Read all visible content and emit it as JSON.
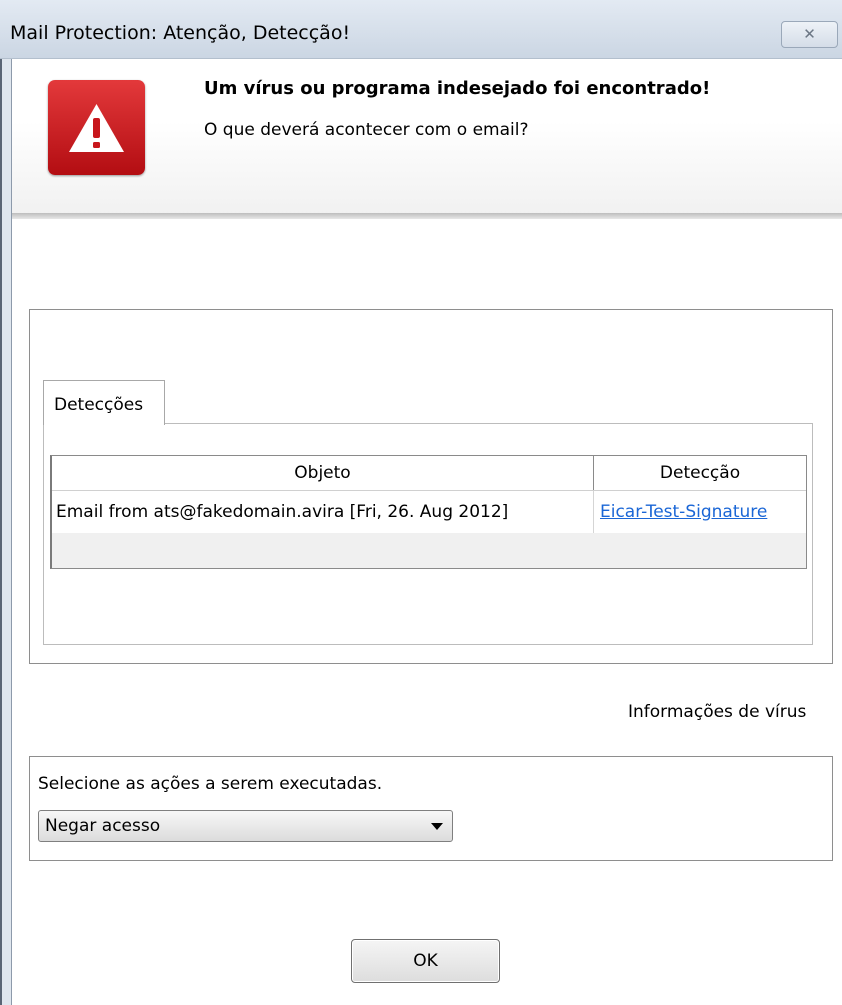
{
  "window": {
    "title": "Mail Protection: Atenção, Detecção!",
    "close_symbol": "✕"
  },
  "header": {
    "icon": "warning-icon",
    "title": "Um vírus ou programa indesejado foi encontrado!",
    "subtitle": "O que deverá acontecer com o email?",
    "accent_color": "#c8161c"
  },
  "detections": {
    "tab_label": "Detecções",
    "columns": [
      "Objeto",
      "Detecção"
    ],
    "rows": [
      {
        "object": "Email from ats@fakedomain.avira [Fri, 26. Aug 2012]",
        "detection": "Eicar-Test-Signature"
      }
    ]
  },
  "virus_info_label": "Informações de vírus",
  "actions": {
    "label": "Selecione as ações a serem executadas.",
    "selected": "Negar acesso"
  },
  "ok_button": "OK"
}
